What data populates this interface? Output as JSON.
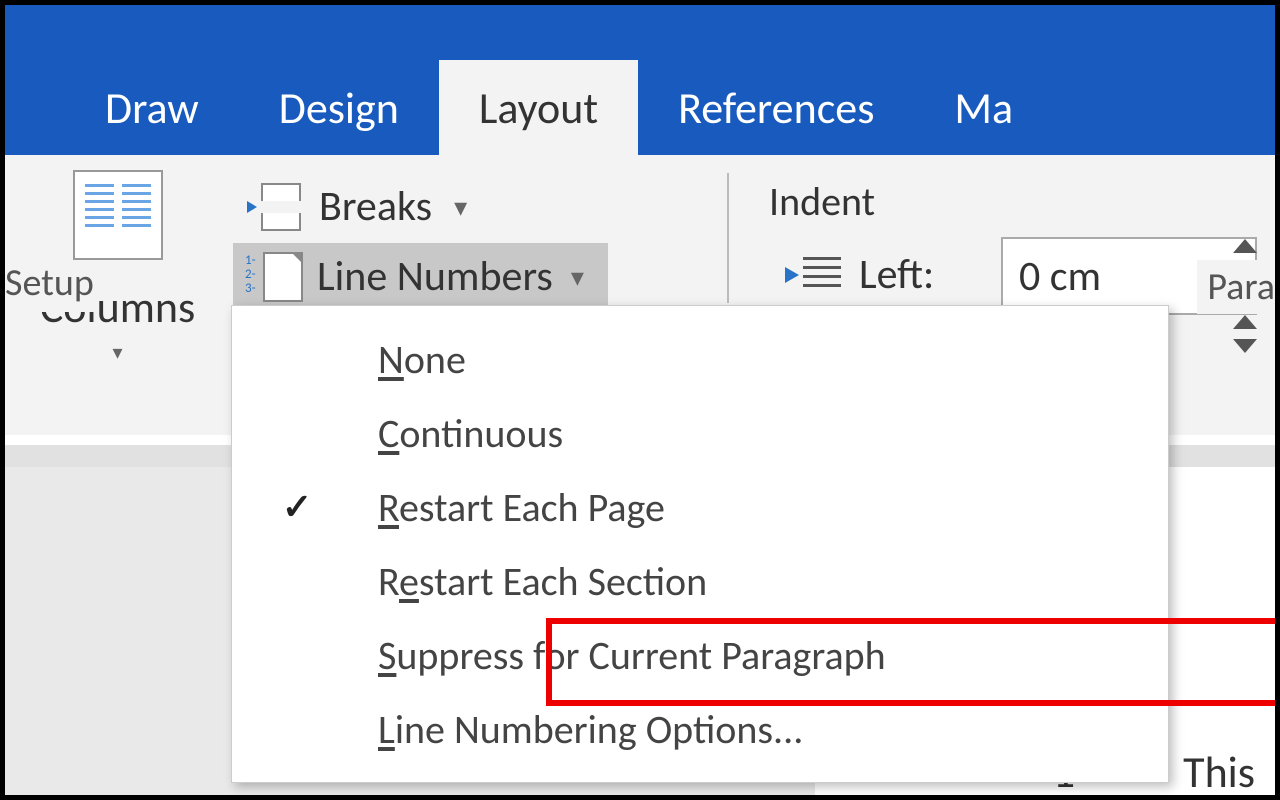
{
  "tabs": {
    "draw": "Draw",
    "design": "Design",
    "layout": "Layout",
    "references": "References",
    "mailings_partial": "Ma"
  },
  "ribbon": {
    "columns_label": "Columns",
    "breaks_label": "Breaks",
    "line_numbers_label": "Line Numbers",
    "indent_header": "Indent",
    "left_label": "Left:",
    "left_value": "0 cm"
  },
  "group_labels": {
    "setup": "Setup",
    "paragraph": "Para"
  },
  "dropdown": {
    "none": "one",
    "none_u": "N",
    "continuous": "ontinuous",
    "continuous_u": "C",
    "restart_page": "estart Each Page",
    "restart_page_u": "R",
    "restart_section_pre": "R",
    "restart_section_u": "e",
    "restart_section_post": "start Each Section",
    "suppress": "uppress for Current Paragraph",
    "suppress_u": "S",
    "options": "ine Numbering Options...",
    "options_u": "L"
  },
  "document": {
    "line_number": "1",
    "text_partial": "This"
  }
}
